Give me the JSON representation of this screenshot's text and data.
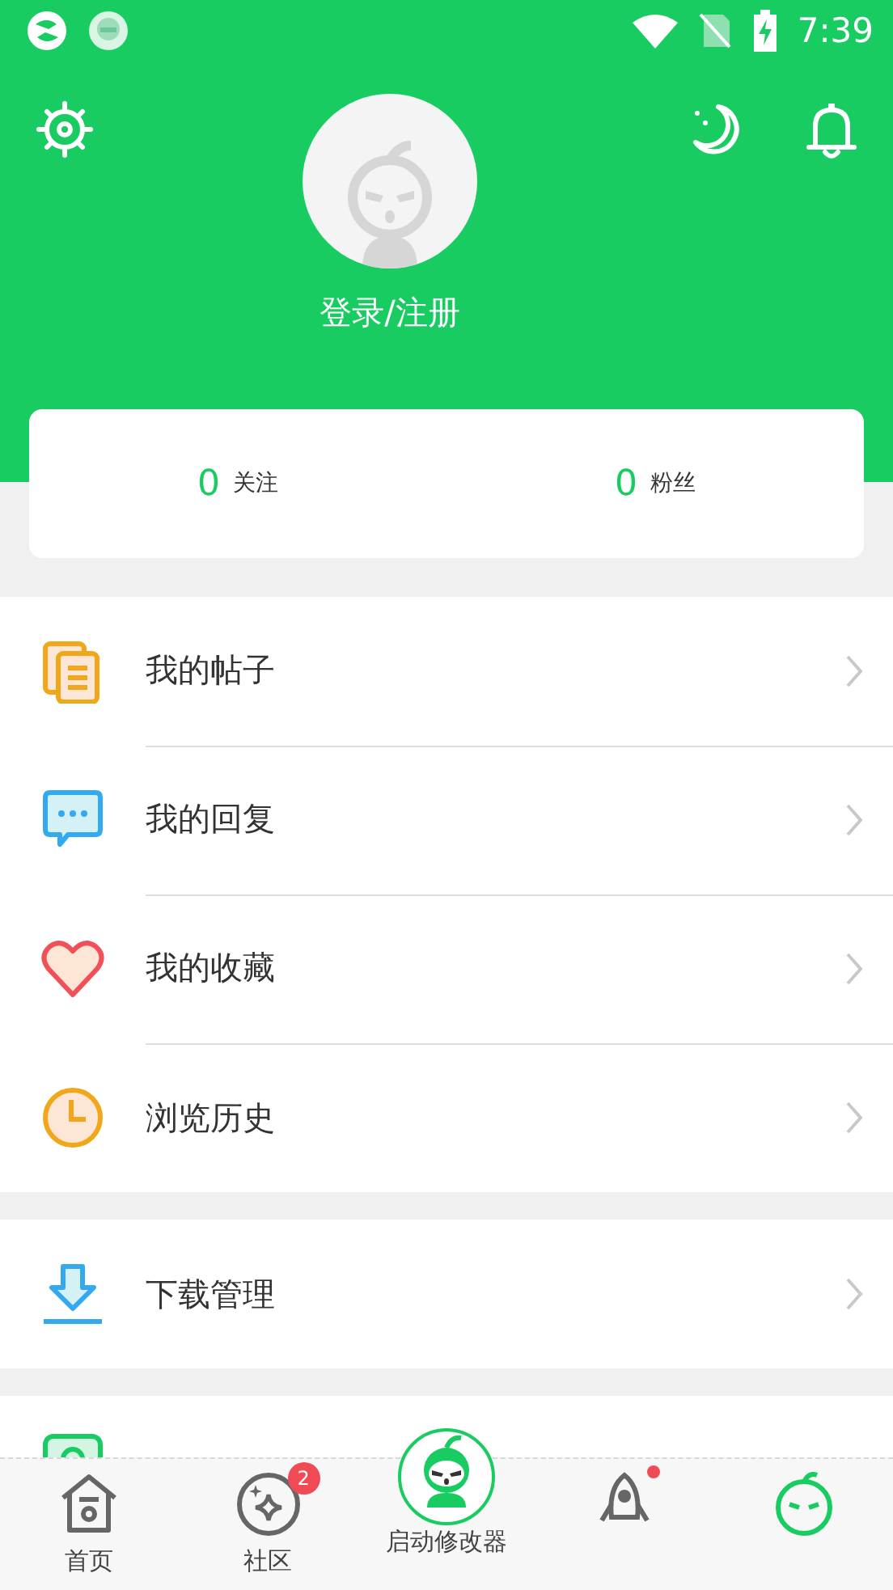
{
  "status_bar": {
    "time": "7:39"
  },
  "header": {
    "login_label": "登录/注册"
  },
  "stats": [
    {
      "count": "0",
      "label": "关注"
    },
    {
      "count": "0",
      "label": "粉丝"
    }
  ],
  "sections": [
    {
      "items": [
        {
          "kind": "posts",
          "label": "我的帖子"
        },
        {
          "kind": "reply",
          "label": "我的回复"
        },
        {
          "kind": "favorite",
          "label": "我的收藏"
        },
        {
          "kind": "history",
          "label": "浏览历史"
        }
      ]
    },
    {
      "items": [
        {
          "kind": "download",
          "label": "下载管理"
        }
      ]
    },
    {
      "items": [
        {
          "kind": "account"
        }
      ]
    }
  ],
  "tabs": [
    {
      "kind": "home",
      "label": "首页",
      "selected": false
    },
    {
      "kind": "community",
      "label": "社区",
      "badge": "2",
      "selected": false
    },
    {
      "kind": "launcher",
      "label": "启动修改器",
      "selected": false
    },
    {
      "kind": "rocket",
      "dot": true,
      "selected": false
    },
    {
      "kind": "face",
      "selected": true
    }
  ]
}
